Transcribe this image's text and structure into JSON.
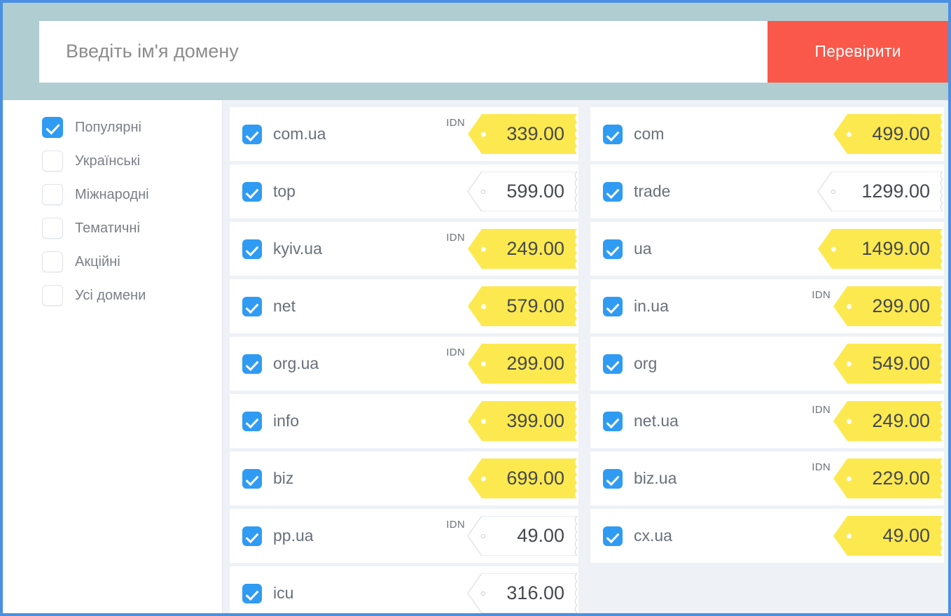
{
  "search": {
    "placeholder": "Введіть ім'я домену",
    "value": "",
    "button_label": "Перевірити",
    "button_color": "#f9584a",
    "header_bg": "#b0cdd1"
  },
  "sidebar": {
    "items": [
      {
        "label": "Популярні",
        "checked": true
      },
      {
        "label": "Українські",
        "checked": false
      },
      {
        "label": "Міжнародні",
        "checked": false
      },
      {
        "label": "Тематичні",
        "checked": false
      },
      {
        "label": "Акційні",
        "checked": false
      },
      {
        "label": "Усі домени",
        "checked": false
      }
    ]
  },
  "colors": {
    "checkbox": "#2f9bf3",
    "promo_tag": "#fce94f",
    "regular_tag": "#ffffff",
    "page_border": "#4a90e2",
    "list_bg": "#eef1f6"
  },
  "idn_label": "IDN",
  "columns": [
    {
      "rows": [
        {
          "domain": "com.ua",
          "price": "339.00",
          "idn": true,
          "promo": true
        },
        {
          "domain": "top",
          "price": "599.00",
          "idn": false,
          "promo": false
        },
        {
          "domain": "kyiv.ua",
          "price": "249.00",
          "idn": true,
          "promo": true
        },
        {
          "domain": "net",
          "price": "579.00",
          "idn": false,
          "promo": true
        },
        {
          "domain": "org.ua",
          "price": "299.00",
          "idn": true,
          "promo": true
        },
        {
          "domain": "info",
          "price": "399.00",
          "idn": false,
          "promo": true
        },
        {
          "domain": "biz",
          "price": "699.00",
          "idn": false,
          "promo": true
        },
        {
          "domain": "pp.ua",
          "price": "49.00",
          "idn": true,
          "promo": false
        },
        {
          "domain": "icu",
          "price": "316.00",
          "idn": false,
          "promo": false
        }
      ]
    },
    {
      "rows": [
        {
          "domain": "com",
          "price": "499.00",
          "idn": false,
          "promo": true
        },
        {
          "domain": "trade",
          "price": "1299.00",
          "idn": false,
          "promo": false
        },
        {
          "domain": "ua",
          "price": "1499.00",
          "idn": false,
          "promo": true
        },
        {
          "domain": "in.ua",
          "price": "299.00",
          "idn": true,
          "promo": true
        },
        {
          "domain": "org",
          "price": "549.00",
          "idn": false,
          "promo": true
        },
        {
          "domain": "net.ua",
          "price": "249.00",
          "idn": true,
          "promo": true
        },
        {
          "domain": "biz.ua",
          "price": "229.00",
          "idn": true,
          "promo": true
        },
        {
          "domain": "cx.ua",
          "price": "49.00",
          "idn": false,
          "promo": true
        }
      ]
    }
  ]
}
